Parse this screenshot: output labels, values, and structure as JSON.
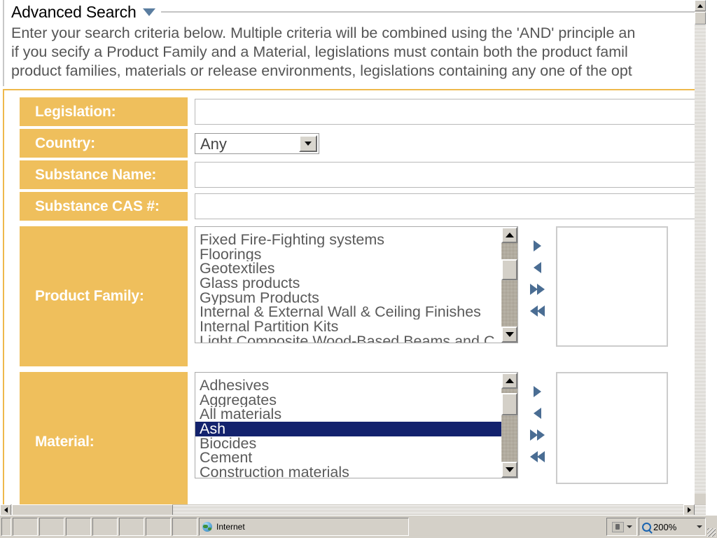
{
  "header": {
    "title": "Advanced Search",
    "collapse_icon": "chevron-down-icon"
  },
  "intro": {
    "line1": "Enter your search criteria below. Multiple criteria will be combined using the 'AND' principle an",
    "line2": "if you secify a Product Family and a Material, legislations must contain both the product famil",
    "line3": "product families, materials or release environments, legislations containing any one of the opt"
  },
  "form": {
    "legislation": {
      "label": "Legislation:",
      "value": ""
    },
    "country": {
      "label": "Country:",
      "value": "Any"
    },
    "substance_name": {
      "label": "Substance Name:",
      "value": ""
    },
    "substance_cas": {
      "label": "Substance CAS #:",
      "value": ""
    },
    "product_family": {
      "label": "Product Family:",
      "options": [
        "Fixed Fire-Fighting systems",
        "Floorings",
        "Geotextiles",
        "Glass products",
        "Gypsum Products",
        "Internal & External Wall & Ceiling Finishes",
        "Internal Partition Kits",
        "Light Composite Wood-Based Beams and C"
      ],
      "selected": [],
      "target_items": []
    },
    "material": {
      "label": "Material:",
      "options": [
        "Adhesives",
        "Aggregates",
        "All materials",
        "Ash",
        "Biocides",
        "Cement",
        "Construction materials"
      ],
      "selected": [
        "Ash"
      ],
      "target_items": []
    }
  },
  "transfer_buttons": {
    "add": "move-right-icon",
    "remove": "move-left-icon",
    "add_all": "move-all-right-icon",
    "remove_all": "move-all-left-icon"
  },
  "statusbar": {
    "zone": "Internet",
    "zone_icon": "globe-icon",
    "security_icon": "lock-icon",
    "zoom_icon": "magnifier-icon",
    "zoom_level": "200%"
  },
  "colors": {
    "label_orange": "#efbf5c",
    "panel_border": "#eeb94c",
    "selection_navy": "#13226d",
    "arrow_blue": "#4a6d93",
    "text_gray": "#5a5a5a"
  }
}
